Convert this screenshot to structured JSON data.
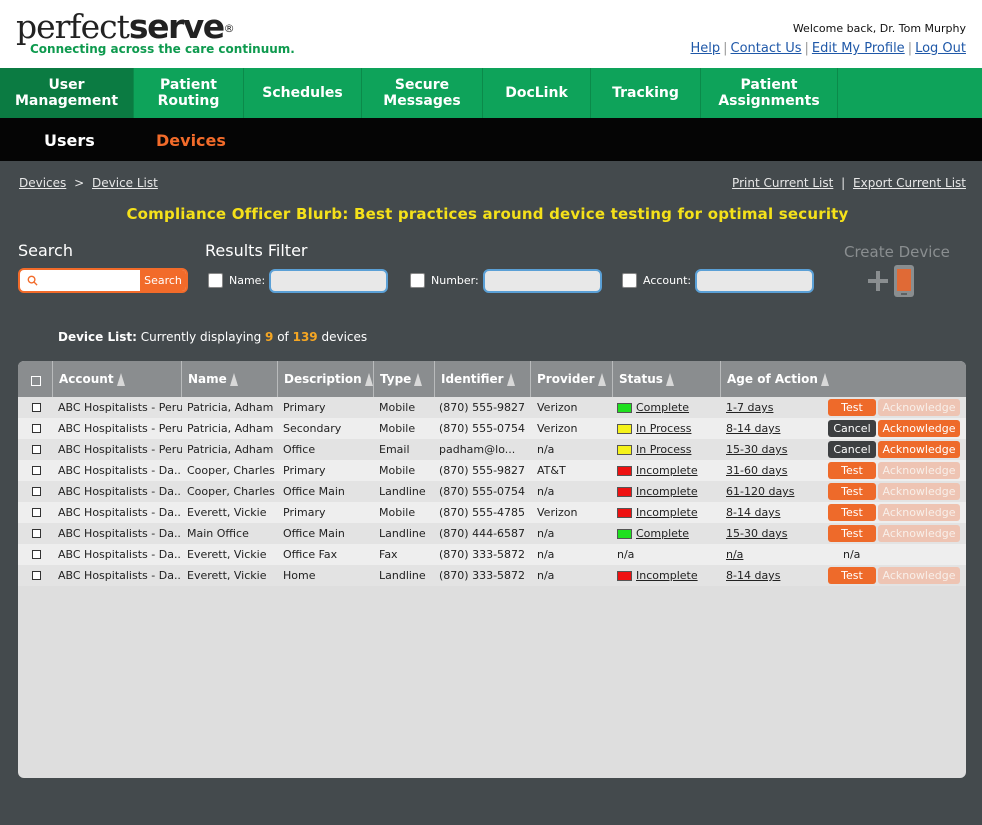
{
  "brand": {
    "logo_light": "perfect",
    "logo_bold": "serve",
    "logo_mark": "®",
    "tagline": "Connecting across the care continuum."
  },
  "user": {
    "welcome": "Welcome back, Dr. Tom Murphy"
  },
  "top_links": [
    "Help",
    "Contact Us",
    "Edit My Profile",
    "Log Out"
  ],
  "nav": [
    {
      "label": "User\nManagement",
      "active": true
    },
    {
      "label": "Patient\nRouting",
      "active": false
    },
    {
      "label": "Schedules",
      "active": false
    },
    {
      "label": "Secure\nMessages",
      "active": false
    },
    {
      "label": "DocLink",
      "active": false
    },
    {
      "label": "Tracking",
      "active": false
    },
    {
      "label": "Patient\nAssignments",
      "active": false
    }
  ],
  "subnav": {
    "users": "Users",
    "devices": "Devices"
  },
  "breadcrumb": {
    "root": "Devices",
    "separator": ">",
    "current": "Device List"
  },
  "export": {
    "print": "Print Current List",
    "separator": "|",
    "export": "Export Current List"
  },
  "blurb": "Compliance Officer Blurb: Best practices around device testing for optimal security",
  "search": {
    "label": "Search",
    "value": "",
    "button": "Search"
  },
  "filter": {
    "label": "Results Filter",
    "name_label": "Name:",
    "number_label": "Number:",
    "account_label": "Account:"
  },
  "create_device": "Create Device",
  "device_list": {
    "prefix": "Device List:",
    "text1": " Currently displaying ",
    "shown": "9",
    "text2": " of ",
    "total": "139",
    "text3": " devices"
  },
  "columns": [
    "Account",
    "Name",
    "Description",
    "Type",
    "Identifier",
    "Provider",
    "Status",
    "Age of Action"
  ],
  "colors": {
    "green": "#1fe01f",
    "yellow": "#f5f21a",
    "red": "#ee1111"
  },
  "rows": [
    {
      "account": "ABC Hospitalists - Peru",
      "name": "Patricia, Adham",
      "description": "Primary",
      "type": "Mobile",
      "identifier": "(870) 555-9827",
      "provider": "Verizon",
      "status": "Complete",
      "status_color": "green",
      "age": "1-7 days",
      "action1": "Test",
      "action2": "Acknowledge",
      "ack_enabled": false
    },
    {
      "account": "ABC Hospitalists - Peru",
      "name": "Patricia, Adham",
      "description": "Secondary",
      "type": "Mobile",
      "identifier": "(870) 555-0754",
      "provider": "Verizon",
      "status": "In Process",
      "status_color": "yellow",
      "age": "8-14 days",
      "action1": "Cancel",
      "action2": "Acknowledge",
      "ack_enabled": true
    },
    {
      "account": "ABC Hospitalists - Peru",
      "name": "Patricia, Adham",
      "description": "Office",
      "type": "Email",
      "identifier": "padham@lo...",
      "provider": "n/a",
      "status": "In Process",
      "status_color": "yellow",
      "age": "15-30 days",
      "action1": "Cancel",
      "action2": "Acknowledge",
      "ack_enabled": true
    },
    {
      "account": "ABC Hospitalists - Da...",
      "name": "Cooper, Charles",
      "description": "Primary",
      "type": "Mobile",
      "identifier": "(870) 555-9827",
      "provider": "AT&T",
      "status": "Incomplete",
      "status_color": "red",
      "age": "31-60 days",
      "action1": "Test",
      "action2": "Acknowledge",
      "ack_enabled": false
    },
    {
      "account": "ABC Hospitalists - Da...",
      "name": "Cooper, Charles",
      "description": "Office Main",
      "type": "Landline",
      "identifier": "(870) 555-0754",
      "provider": "n/a",
      "status": "Incomplete",
      "status_color": "red",
      "age": "61-120 days",
      "action1": "Test",
      "action2": "Acknowledge",
      "ack_enabled": false
    },
    {
      "account": "ABC Hospitalists - Da...",
      "name": "Everett, Vickie",
      "description": "Primary",
      "type": "Mobile",
      "identifier": "(870) 555-4785",
      "provider": "Verizon",
      "status": "Incomplete",
      "status_color": "red",
      "age": "8-14 days",
      "action1": "Test",
      "action2": "Acknowledge",
      "ack_enabled": false
    },
    {
      "account": "ABC Hospitalists - Da...",
      "name": "Main Office",
      "description": "Office Main",
      "type": "Landline",
      "identifier": "(870) 444-6587",
      "provider": "n/a",
      "status": "Complete",
      "status_color": "green",
      "age": "15-30 days",
      "action1": "Test",
      "action2": "Acknowledge",
      "ack_enabled": false
    },
    {
      "account": "ABC Hospitalists - Da...",
      "name": "Everett, Vickie",
      "description": "Office Fax",
      "type": "Fax",
      "identifier": "(870) 333-5872",
      "provider": "n/a",
      "status": "n/a",
      "status_color": "",
      "age": "n/a",
      "action1": "n/a",
      "action2": "",
      "ack_enabled": false
    },
    {
      "account": "ABC Hospitalists - Da...",
      "name": "Everett, Vickie",
      "description": "Home",
      "type": "Landline",
      "identifier": "(870) 333-5872",
      "provider": "n/a",
      "status": "Incomplete",
      "status_color": "red",
      "age": "8-14 days",
      "action1": "Test",
      "action2": "Acknowledge",
      "ack_enabled": false
    }
  ]
}
